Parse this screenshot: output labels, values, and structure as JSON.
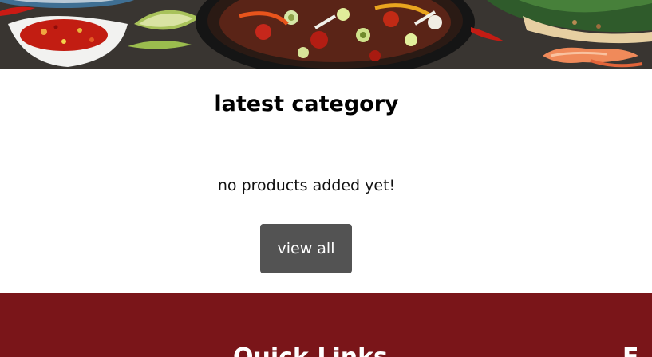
{
  "hero": {
    "image_description_icon": "food-banner-image"
  },
  "section": {
    "title": "latest category",
    "empty_message": "no products added yet!",
    "view_all_label": "view all"
  },
  "footer": {
    "heading_1": "Quick Links",
    "heading_2": "E",
    "background_color": "#7a1519"
  },
  "colors": {
    "button_bg": "#535353",
    "button_text": "#ffffff",
    "title_text": "#000000"
  }
}
